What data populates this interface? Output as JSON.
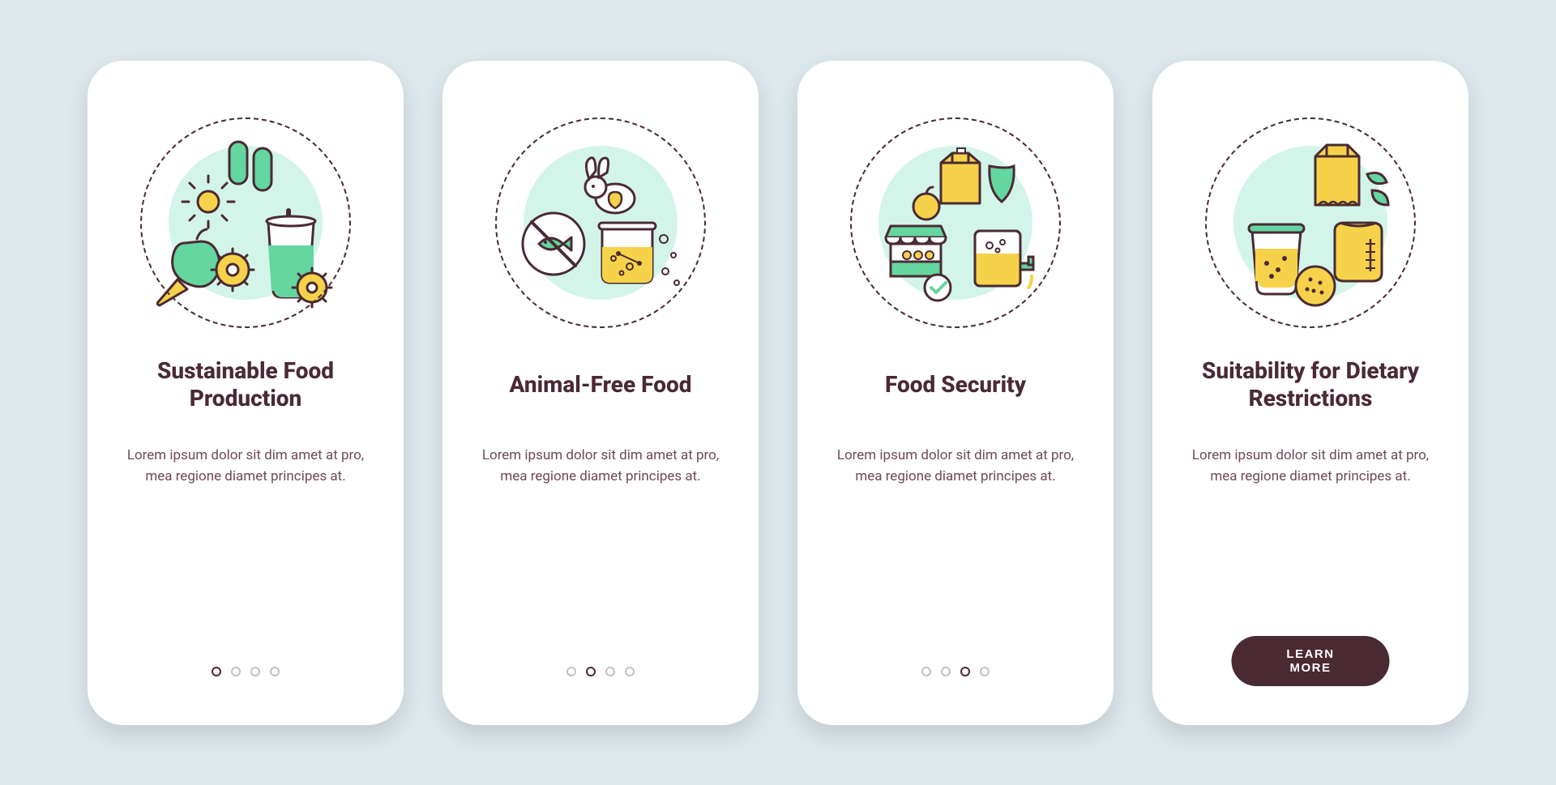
{
  "colors": {
    "background": "#dde8ec",
    "card": "#ffffff",
    "text_primary": "#4a2a33",
    "text_secondary": "#6f4a53",
    "accent_green": "#64d6a0",
    "accent_yellow": "#f6d24a",
    "mint_bg": "#b5eedb",
    "dot_inactive": "#c9bdc1"
  },
  "screens": [
    {
      "icon_name": "sustainable-production-icon",
      "title": "Sustainable Food Production",
      "description": "Lorem ipsum dolor sit dim amet at pro, mea regione diamet principes at.",
      "active_index": 0,
      "has_cta": false
    },
    {
      "icon_name": "animal-free-icon",
      "title": "Animal-Free Food",
      "description": "Lorem ipsum dolor sit dim amet at pro, mea regione diamet principes at.",
      "active_index": 1,
      "has_cta": false
    },
    {
      "icon_name": "food-security-icon",
      "title": "Food Security",
      "description": "Lorem ipsum dolor sit dim amet at pro, mea regione diamet principes at.",
      "active_index": 2,
      "has_cta": false
    },
    {
      "icon_name": "dietary-restrictions-icon",
      "title": "Suitability for Dietary Restrictions",
      "description": "Lorem ipsum dolor sit dim amet at pro, mea regione diamet principes at.",
      "active_index": 3,
      "has_cta": true
    }
  ],
  "dot_count": 4,
  "cta_label": "LEARN MORE"
}
